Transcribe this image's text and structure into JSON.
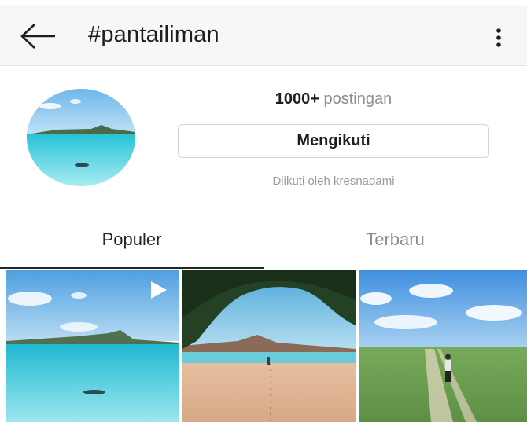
{
  "header": {
    "title": "#pantailiman",
    "back_icon": "arrow-left-icon",
    "more_icon": "vertical-dots-icon"
  },
  "profile": {
    "post_count": "1000+",
    "post_label": "postingan",
    "follow_button_label": "Mengikuti",
    "followed_by_text": "Diikuti oleh kresnadami"
  },
  "tabs": [
    {
      "label": "Populer",
      "active": true
    },
    {
      "label": "Terbaru",
      "active": false
    }
  ],
  "grid": {
    "tiles": [
      {
        "name": "beach-sea-video",
        "video_icon": "play-icon"
      },
      {
        "name": "beach-tree-shore"
      },
      {
        "name": "grass-path-person"
      }
    ]
  },
  "colors": {
    "text_primary": "#262626",
    "text_secondary": "#8e8e8e",
    "header_bg": "#f7f7f7",
    "border": "#d4d4d4"
  }
}
